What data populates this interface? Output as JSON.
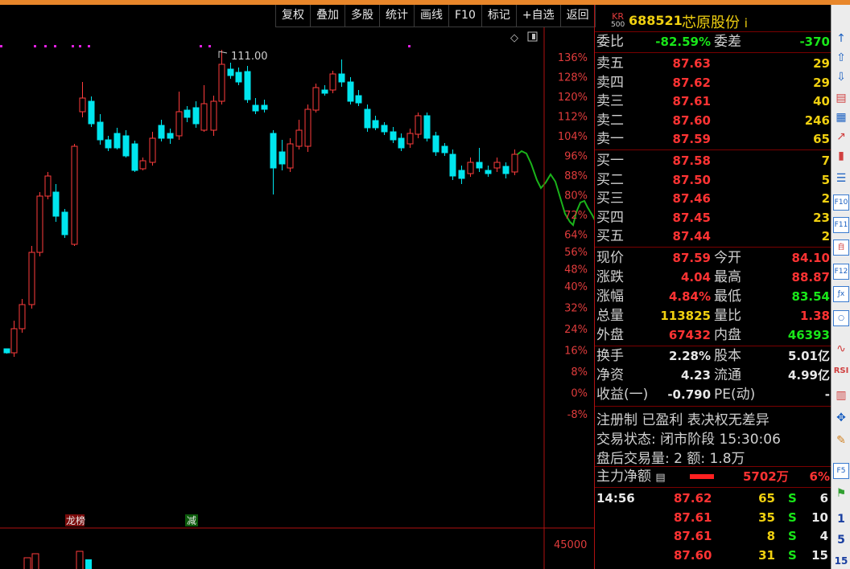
{
  "toolbar": {
    "buttons": [
      "复权",
      "叠加",
      "多股",
      "统计",
      "画线",
      "F10",
      "标记",
      "+自选",
      "返回"
    ]
  },
  "chart": {
    "high_marker": "111.00",
    "y_ticks": [
      "136%",
      "128%",
      "120%",
      "112%",
      "104%",
      "96%",
      "88%",
      "80%",
      "72%",
      "64%",
      "56%",
      "48%",
      "40%",
      "32%",
      "24%",
      "16%",
      "8%",
      "0%",
      "-8%"
    ],
    "volume_tick": "45000",
    "tag_lhb": "龙榜",
    "tag_jian": "减",
    "colors": {
      "up": "#ff3c3c",
      "down": "#00e5ee",
      "accent_line": "#1ab31a",
      "dots": "#e020e0"
    }
  },
  "quote": {
    "badge_top": "KR",
    "badge_bottom": "500",
    "code": "688521",
    "name": "芯原股份",
    "info_icon": "i",
    "weibi": {
      "label": "委比",
      "value": "-82.59%",
      "label2": "委差",
      "value2": "-370"
    },
    "asks": [
      {
        "label": "卖五",
        "price": "87.63",
        "vol": "29"
      },
      {
        "label": "卖四",
        "price": "87.62",
        "vol": "29"
      },
      {
        "label": "卖三",
        "price": "87.61",
        "vol": "40"
      },
      {
        "label": "卖二",
        "price": "87.60",
        "vol": "246"
      },
      {
        "label": "卖一",
        "price": "87.59",
        "vol": "65"
      }
    ],
    "bids": [
      {
        "label": "买一",
        "price": "87.58",
        "vol": "7"
      },
      {
        "label": "买二",
        "price": "87.50",
        "vol": "5"
      },
      {
        "label": "买三",
        "price": "87.46",
        "vol": "2"
      },
      {
        "label": "买四",
        "price": "87.45",
        "vol": "23"
      },
      {
        "label": "买五",
        "price": "87.44",
        "vol": "2"
      }
    ],
    "stats": [
      {
        "l1": "现价",
        "v1": "87.59",
        "c1": "red",
        "l2": "今开",
        "v2": "84.10",
        "c2": "red"
      },
      {
        "l1": "涨跌",
        "v1": "4.04",
        "c1": "red",
        "l2": "最高",
        "v2": "88.87",
        "c2": "red"
      },
      {
        "l1": "涨幅",
        "v1": "4.84%",
        "c1": "red",
        "l2": "最低",
        "v2": "83.54",
        "c2": "green"
      },
      {
        "l1": "总量",
        "v1": "113825",
        "c1": "yellow",
        "l2": "量比",
        "v2": "1.38",
        "c2": "red"
      },
      {
        "l1": "外盘",
        "v1": "67432",
        "c1": "red",
        "l2": "内盘",
        "v2": "46393",
        "c2": "green"
      }
    ],
    "fundamentals": [
      {
        "l1": "换手",
        "v1": "2.28%",
        "l2": "股本",
        "v2": "5.01亿"
      },
      {
        "l1": "净资",
        "v1": "4.23",
        "l2": "流通",
        "v2": "4.99亿"
      },
      {
        "l1": "收益(一)",
        "v1": "-0.790",
        "l2": "PE(动)",
        "v2": "-"
      }
    ],
    "reg_line": "注册制 已盈利 表决权无差异",
    "status_line": "交易状态: 闭市阶段 15:30:06",
    "after_hours": "盘后交易量: 2  额: 1.8万",
    "main_force": {
      "label": "主力净额",
      "value": "5702万",
      "pct": "6%"
    },
    "ticks": [
      {
        "time": "14:56",
        "price": "87.62",
        "vol": "65",
        "bs": "S",
        "n": "6"
      },
      {
        "time": "",
        "price": "87.61",
        "vol": "35",
        "bs": "S",
        "n": "10"
      },
      {
        "time": "",
        "price": "87.61",
        "vol": "8",
        "bs": "S",
        "n": "4"
      },
      {
        "time": "",
        "price": "87.60",
        "vol": "31",
        "bs": "S",
        "n": "15"
      }
    ]
  },
  "sidebar": {
    "items": [
      "↑",
      "⇧",
      "⇩",
      "F9",
      "F10",
      "F11",
      "F12",
      "1",
      "5",
      "15"
    ]
  }
}
